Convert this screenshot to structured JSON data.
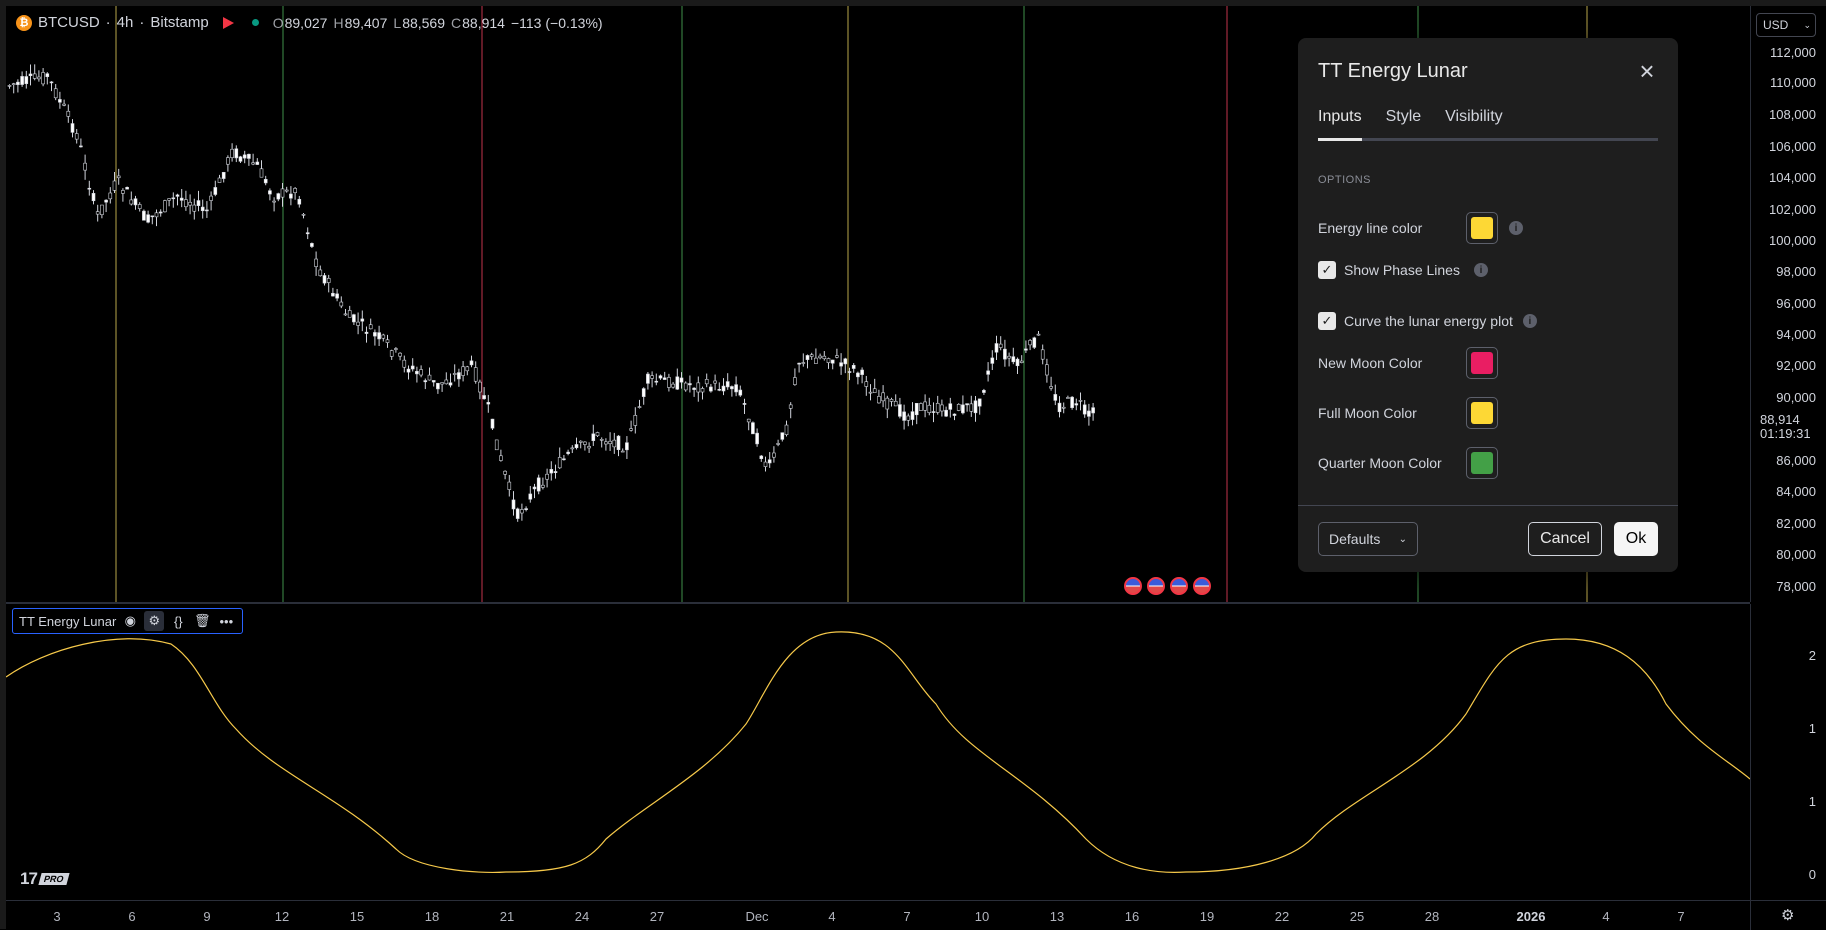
{
  "symbol": {
    "name": "BTCUSD",
    "separator1": "·",
    "interval": "4h",
    "separator2": "·",
    "exchange": "Bitstamp",
    "open_label": "O",
    "open": "89,027",
    "high_label": "H",
    "high": "89,407",
    "low_label": "L",
    "low": "88,569",
    "close_label": "C",
    "close": "88,914",
    "change": "−113 (−0.13%)"
  },
  "price_scale": {
    "currency": "USD",
    "labels": [
      "112,000",
      "110,000",
      "108,000",
      "106,000",
      "104,000",
      "102,000",
      "100,000",
      "98,000",
      "96,000",
      "94,000",
      "92,000",
      "90,000",
      "86,000",
      "84,000",
      "82,000",
      "80,000",
      "78,000"
    ],
    "last_price": "88,914",
    "countdown": "01:19:31"
  },
  "oscillator": {
    "name": "TT Energy Lunar",
    "scale_labels": [
      "2",
      "1",
      "1",
      "0"
    ]
  },
  "time_axis": {
    "labels": [
      "3",
      "6",
      "9",
      "12",
      "15",
      "18",
      "21",
      "24",
      "27",
      "Dec",
      "4",
      "7",
      "10",
      "13",
      "16",
      "19",
      "22",
      "25",
      "28",
      "2026",
      "4",
      "7"
    ]
  },
  "logo": {
    "mark": "17",
    "badge": "PRO"
  },
  "colors": {
    "energy_line": "#f6c94a",
    "new_moon": "#e91e63",
    "full_moon": "#fdd835",
    "quarter_moon": "#43a047",
    "phase_line_red": "#c2334d",
    "phase_line_green": "#3f8f4a",
    "phase_line_yellow": "#b9a64a",
    "accent": "#2962ff"
  },
  "dialog": {
    "title": "TT Energy Lunar",
    "tabs": [
      "Inputs",
      "Style",
      "Visibility"
    ],
    "section": "OPTIONS",
    "energy_line_label": "Energy line color",
    "show_phase_label": "Show Phase Lines",
    "curve_label": "Curve the lunar energy plot",
    "new_moon_label": "New Moon Color",
    "full_moon_label": "Full Moon Color",
    "quarter_moon_label": "Quarter Moon Color",
    "defaults_label": "Defaults",
    "cancel_label": "Cancel",
    "ok_label": "Ok"
  }
}
